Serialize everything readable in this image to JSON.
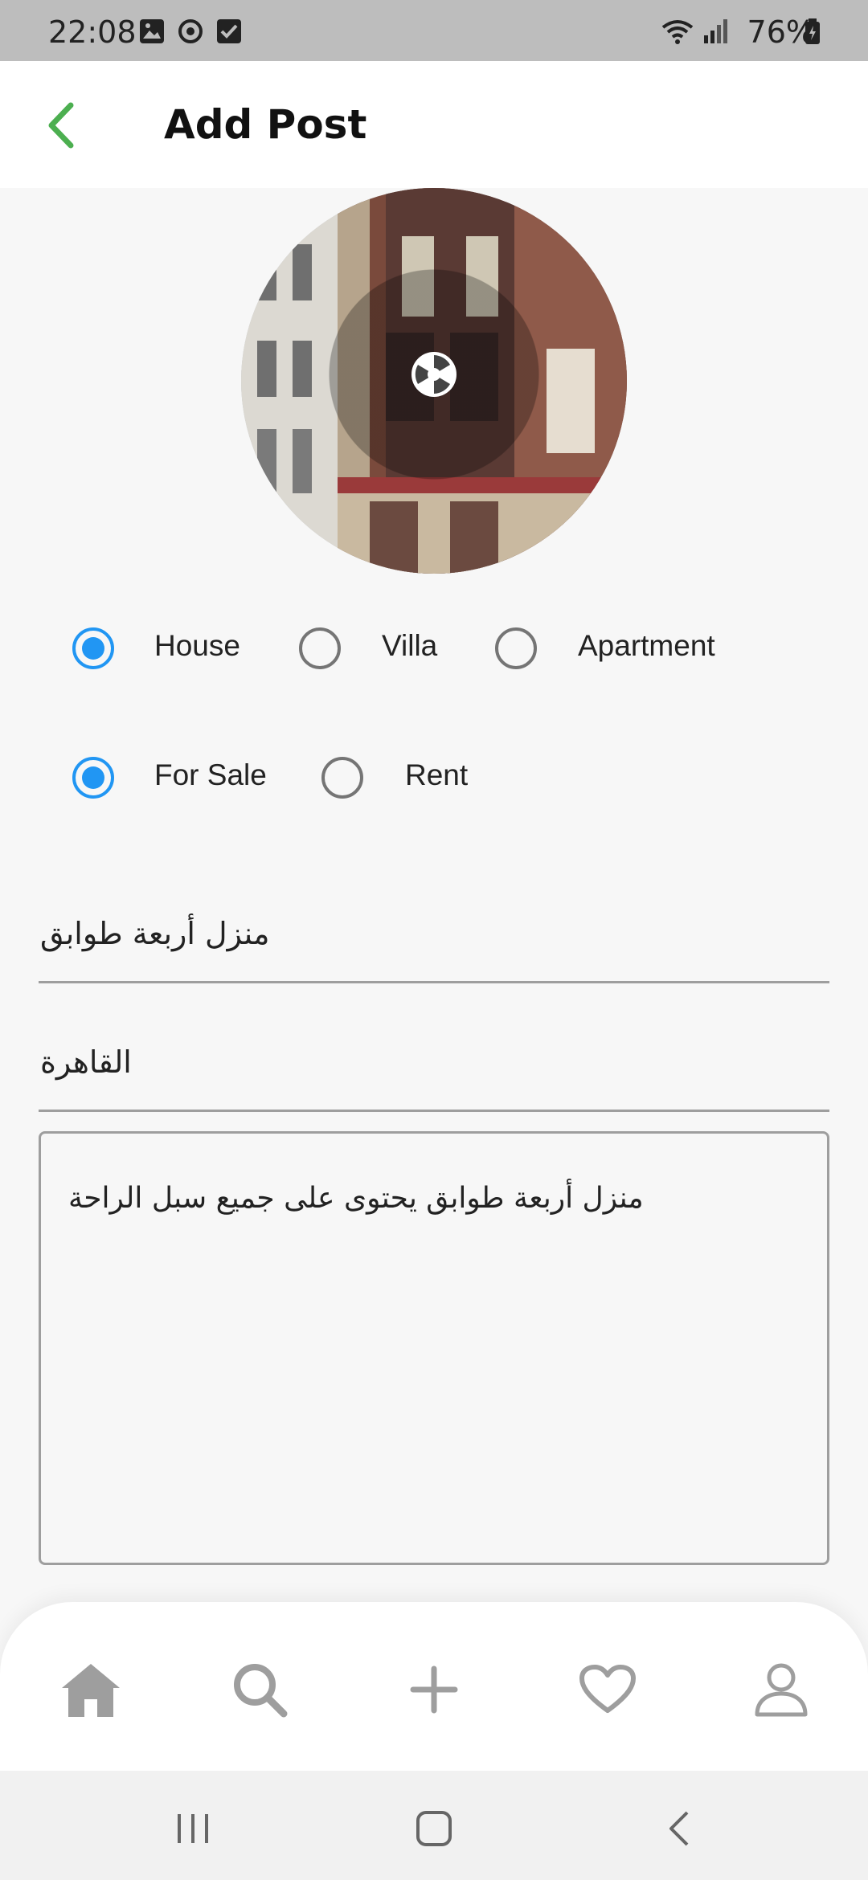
{
  "status_bar": {
    "time": "22:08",
    "battery": "76%",
    "icons_left": [
      "image-icon",
      "sync-icon",
      "checkbox-icon"
    ],
    "icons_right": [
      "wifi-icon",
      "signal-icon",
      "battery-icon"
    ]
  },
  "app_bar": {
    "title": "Add Post",
    "back_color": "#4caf50"
  },
  "photo": {
    "subject": "building-photo",
    "overlay_icon": "camera-shutter-icon"
  },
  "property_type": {
    "options": [
      "House",
      "Villa",
      "Apartment"
    ],
    "selected": "House"
  },
  "listing_type": {
    "options": [
      "For Sale",
      "Rent"
    ],
    "selected": "For Sale"
  },
  "form": {
    "title_value": "منزل أربعة طوابق",
    "location_value": "القاهرة",
    "description_value": "منزل أربعة طوابق يحتوى على جميع سبل الراحة"
  },
  "bottom_nav": {
    "items": [
      "home-icon",
      "search-icon",
      "add-icon",
      "heart-icon",
      "profile-icon"
    ],
    "active": "home-icon"
  },
  "colors": {
    "accent": "#2196f3",
    "back_arrow": "#4caf50",
    "nav_icon": "#9e9e9e"
  }
}
